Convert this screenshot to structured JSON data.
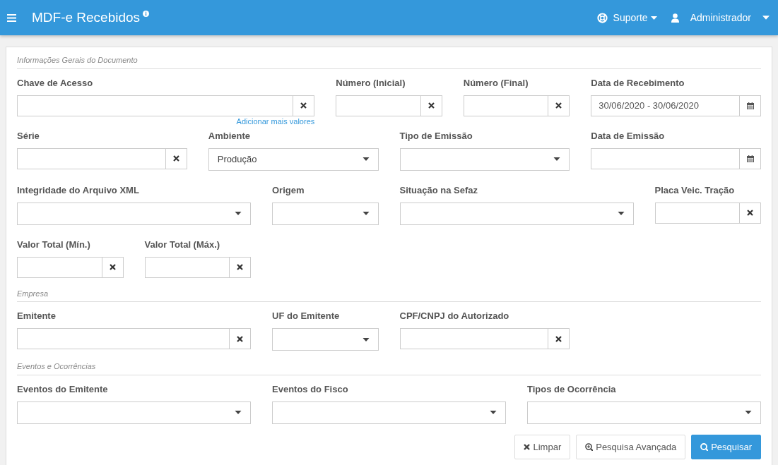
{
  "navbar": {
    "title": "MDF-e Recebidos",
    "support": "Suporte",
    "user": "Administrador"
  },
  "sections": [
    {
      "title": "Informações Gerais do Documento",
      "fields": [
        {
          "label": "Chave de Acesso",
          "kind": "text",
          "link": "Adicionar mais valores"
        },
        {
          "label": "Número (Inicial)",
          "kind": "text"
        },
        {
          "label": "Número (Final)",
          "kind": "text"
        },
        {
          "label": "Data de Recebimento",
          "kind": "date",
          "value": "30/06/2020 - 30/06/2020"
        },
        {
          "label": "Série",
          "kind": "text"
        },
        {
          "label": "Ambiente",
          "kind": "select",
          "value": "Produção"
        },
        {
          "label": "Tipo de Emissão",
          "kind": "select"
        },
        {
          "label": "Data de Emissão",
          "kind": "date"
        },
        {
          "label": "Integridade do Arquivo XML",
          "kind": "select"
        },
        {
          "label": "Origem",
          "kind": "select"
        },
        {
          "label": "Situação na Sefaz",
          "kind": "select"
        },
        {
          "label": "Placa Veic. Tração",
          "kind": "text"
        },
        {
          "label": "Valor Total (Mín.)",
          "kind": "text"
        },
        {
          "label": "Valor Total (Máx.)",
          "kind": "text"
        }
      ]
    },
    {
      "title": "Empresa",
      "fields": [
        {
          "label": "Emitente",
          "kind": "text"
        },
        {
          "label": "UF do Emitente",
          "kind": "select"
        },
        {
          "label": "CPF/CNPJ do Autorizado",
          "kind": "text"
        }
      ]
    },
    {
      "title": "Eventos e Ocorrências",
      "fields": [
        {
          "label": "Eventos do Emitente",
          "kind": "select"
        },
        {
          "label": "Eventos do Fisco",
          "kind": "select"
        },
        {
          "label": "Tipos de Ocorrência",
          "kind": "select"
        }
      ]
    }
  ],
  "buttons": [
    {
      "label": "Limpar",
      "kind": "clear"
    },
    {
      "label": "Pesquisa Avançada",
      "kind": "advanced"
    },
    {
      "label": "Pesquisar",
      "kind": "search"
    }
  ]
}
